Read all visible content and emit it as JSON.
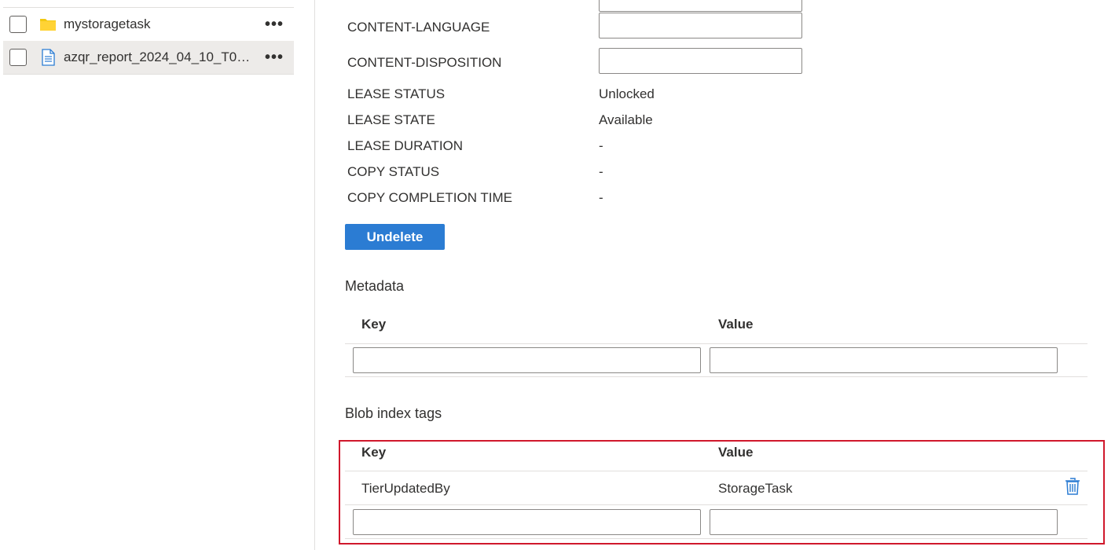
{
  "file_list": [
    {
      "name": "mystoragetask",
      "type": "folder",
      "selected": false,
      "more_label": "•••"
    },
    {
      "name": "azqr_report_2024_04_10_T074...",
      "type": "file",
      "selected": true,
      "more_label": "•••"
    }
  ],
  "properties": {
    "content_language_label": "CONTENT-LANGUAGE",
    "content_language_value": "",
    "content_disposition_label": "CONTENT-DISPOSITION",
    "content_disposition_value": "",
    "lease_status_label": "LEASE STATUS",
    "lease_status_value": "Unlocked",
    "lease_state_label": "LEASE STATE",
    "lease_state_value": "Available",
    "lease_duration_label": "LEASE DURATION",
    "lease_duration_value": "-",
    "copy_status_label": "COPY STATUS",
    "copy_status_value": "-",
    "copy_completion_label": "COPY COMPLETION TIME",
    "copy_completion_value": "-"
  },
  "undelete_label": "Undelete",
  "metadata": {
    "title": "Metadata",
    "key_header": "Key",
    "value_header": "Value",
    "new_key": "",
    "new_value": ""
  },
  "blob_index_tags": {
    "title": "Blob index tags",
    "key_header": "Key",
    "value_header": "Value",
    "rows": [
      {
        "key": "TierUpdatedBy",
        "value": "StorageTask"
      }
    ],
    "new_key": "",
    "new_value": ""
  },
  "icons": {
    "folder": "folder-icon",
    "file": "file-icon",
    "more": "more-icon",
    "delete": "trash-icon"
  },
  "colors": {
    "primary": "#2b7cd3",
    "highlight": "#d0182c",
    "folder": "#f2c811",
    "file_icon": "#2b7cd3"
  }
}
